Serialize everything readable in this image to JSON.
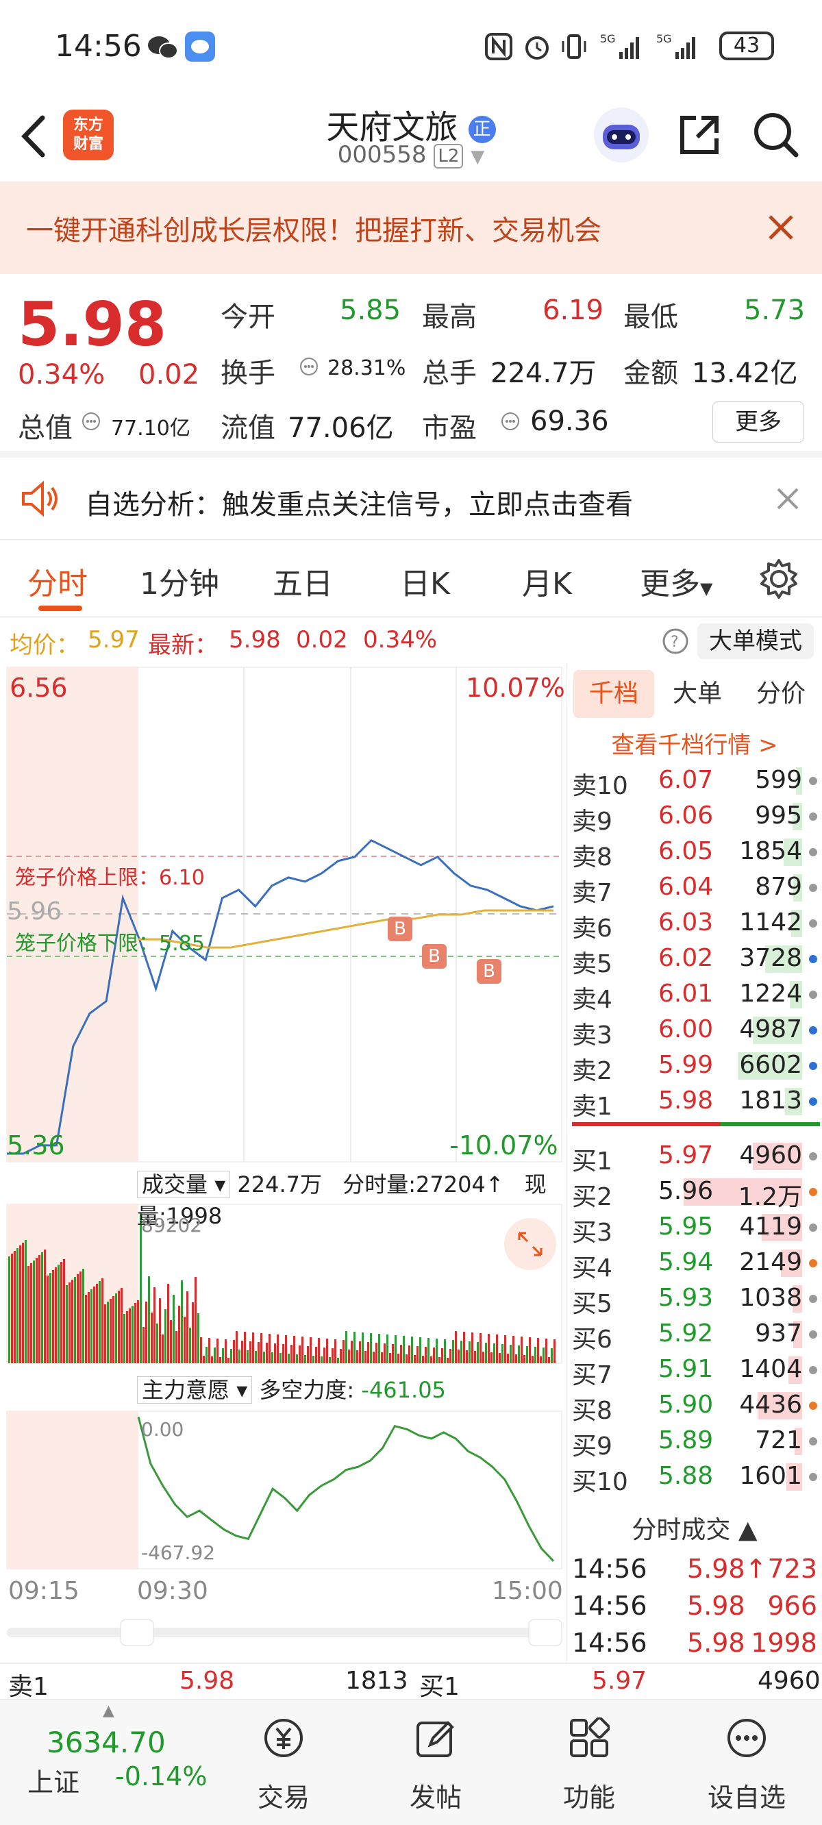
{
  "status_bar": {
    "time": "14:56",
    "battery": "43"
  },
  "header": {
    "logo_line1": "东方",
    "logo_line2": "财富",
    "stock_name": "天府文旅",
    "stock_code": "000558",
    "level_badge": "L2"
  },
  "banner": {
    "text": "一键开通科创成长层权限！把握打新、交易机会"
  },
  "quote": {
    "price": "5.98",
    "change_pct": "0.34%",
    "change": "0.02",
    "open_label": "今开",
    "open": "5.85",
    "high_label": "最高",
    "high": "6.19",
    "low_label": "最低",
    "low": "5.73",
    "turnover_label": "换手",
    "turnover": "28.31%",
    "volume_label": "总手",
    "volume": "224.7万",
    "amount_label": "金额",
    "amount": "13.42亿",
    "mktcap_label": "总值",
    "mktcap": "77.10亿",
    "float_label": "流值",
    "float": "77.06亿",
    "pe_label": "市盈",
    "pe": "69.36",
    "more_label": "更多"
  },
  "notice": {
    "text": "自选分析：触发重点关注信号，立即点击查看"
  },
  "tabs": [
    "分时",
    "1分钟",
    "五日",
    "日K",
    "月K",
    "更多"
  ],
  "avg_row": {
    "avg_label": "均价：",
    "avg": "5.97",
    "latest_label": "最新：",
    "latest": "5.98",
    "change": "0.02",
    "change_pct": "0.34%",
    "big_mode": "大单模式"
  },
  "chart_data": [
    {
      "type": "line",
      "title": "",
      "y_top_label": "6.56",
      "y_bottom_label": "5.36",
      "y_mid_label": "5.96",
      "pct_top": "10.07%",
      "pct_bottom": "-10.07%",
      "cage_upper_label": "笼子价格上限：6.10",
      "cage_lower_label": "笼子价格下限：5.85",
      "ylim": [
        5.36,
        6.56
      ],
      "time_labels": [
        "09:15",
        "09:30",
        "15:00"
      ],
      "markers": [
        "B",
        "B",
        "B"
      ],
      "series": [
        {
          "values": [
            5.38,
            5.38,
            5.4,
            5.4,
            5.64,
            5.72,
            5.75,
            6.0,
            5.9,
            5.78,
            5.92,
            5.88,
            5.85,
            6.0,
            6.02,
            5.98,
            6.03,
            6.05,
            6.04,
            6.06,
            6.09,
            6.1,
            6.14,
            6.12,
            6.1,
            6.08,
            6.1,
            6.06,
            6.03,
            6.02,
            6.0,
            5.98,
            5.97,
            5.98
          ]
        },
        {
          "values": [
            5.9,
            5.9,
            5.89,
            5.88,
            5.88,
            5.89,
            5.9,
            5.91,
            5.92,
            5.93,
            5.94,
            5.95,
            5.95,
            5.96,
            5.96,
            5.97,
            5.97,
            5.97,
            5.97
          ]
        }
      ]
    },
    {
      "type": "bar",
      "title": "成交量",
      "total_label": "224.7万",
      "min_vol_label": "分时量:27204↑",
      "cur_vol_label": "现量:1998",
      "ymax_label": "89202"
    },
    {
      "type": "line",
      "title": "主力意愿",
      "force_label": "多空力度:",
      "force_value": "-461.05",
      "y_top_label": "0.00",
      "y_bottom_label": "-467.92",
      "ylim": [
        -467.92,
        0
      ],
      "series": [
        {
          "values": [
            0,
            -150,
            -220,
            -280,
            -320,
            -300,
            -330,
            -360,
            -380,
            -390,
            -310,
            -230,
            -260,
            -300,
            -250,
            -220,
            -200,
            -170,
            -160,
            -140,
            -100,
            -30,
            -40,
            -60,
            -70,
            -50,
            -70,
            -110,
            -130,
            -160,
            -200,
            -270,
            -350,
            -420,
            -461
          ]
        }
      ]
    }
  ],
  "orderbook": {
    "tabs": [
      "千档",
      "大单",
      "分价"
    ],
    "link": "查看千档行情 >",
    "sells": [
      {
        "label": "卖10",
        "price": "6.07",
        "vol": "599",
        "bar": 0.05,
        "dot": "#999"
      },
      {
        "label": "卖9",
        "price": "6.06",
        "vol": "995",
        "bar": 0.08,
        "dot": "#999"
      },
      {
        "label": "卖8",
        "price": "6.05",
        "vol": "1854",
        "bar": 0.15,
        "dot": "#999"
      },
      {
        "label": "卖7",
        "price": "6.04",
        "vol": "879",
        "bar": 0.07,
        "dot": "#999"
      },
      {
        "label": "卖6",
        "price": "6.03",
        "vol": "1142",
        "bar": 0.09,
        "dot": "#999"
      },
      {
        "label": "卖5",
        "price": "6.02",
        "vol": "3728",
        "bar": 0.3,
        "dot": "#2e6fd6"
      },
      {
        "label": "卖4",
        "price": "6.01",
        "vol": "1224",
        "bar": 0.1,
        "dot": "#999"
      },
      {
        "label": "卖3",
        "price": "6.00",
        "vol": "4987",
        "bar": 0.4,
        "dot": "#2e6fd6"
      },
      {
        "label": "卖2",
        "price": "5.99",
        "vol": "6602",
        "bar": 0.52,
        "dot": "#2e6fd6"
      },
      {
        "label": "卖1",
        "price": "5.98",
        "vol": "1813",
        "bar": 0.14,
        "dot": "#2e6fd6"
      }
    ],
    "buys": [
      {
        "label": "买1",
        "price": "5.97",
        "vol": "4960",
        "bar": 0.4,
        "dot": "#999"
      },
      {
        "label": "买2",
        "price": "5.96",
        "vol": "1.2万",
        "bar": 0.96,
        "dot": "#e87b2a"
      },
      {
        "label": "买3",
        "price": "5.95",
        "vol": "4119",
        "bar": 0.33,
        "dot": "#999"
      },
      {
        "label": "买4",
        "price": "5.94",
        "vol": "2149",
        "bar": 0.17,
        "dot": "#e87b2a"
      },
      {
        "label": "买5",
        "price": "5.93",
        "vol": "1038",
        "bar": 0.08,
        "dot": "#999"
      },
      {
        "label": "买6",
        "price": "5.92",
        "vol": "937",
        "bar": 0.07,
        "dot": "#999"
      },
      {
        "label": "买7",
        "price": "5.91",
        "vol": "1404",
        "bar": 0.11,
        "dot": "#999"
      },
      {
        "label": "买8",
        "price": "5.90",
        "vol": "4436",
        "bar": 0.36,
        "dot": "#e87b2a"
      },
      {
        "label": "买9",
        "price": "5.89",
        "vol": "721",
        "bar": 0.06,
        "dot": "#999"
      },
      {
        "label": "买10",
        "price": "5.88",
        "vol": "1601",
        "bar": 0.13,
        "dot": "#999"
      }
    ],
    "trade_title": "分时成交",
    "trades": [
      {
        "time": "14:56",
        "price": "5.98↑",
        "vol": "723"
      },
      {
        "time": "14:56",
        "price": "5.98",
        "vol": "966"
      },
      {
        "time": "14:56",
        "price": "5.98",
        "vol": "1998"
      }
    ]
  },
  "bidask": {
    "sell1_label": "卖1",
    "sell1_price": "5.98",
    "sell1_vol": "1813",
    "buy1_label": "买1",
    "buy1_price": "5.97",
    "buy1_vol": "4960"
  },
  "bottom_nav": {
    "index_value": "3634.70",
    "index_name": "上证",
    "index_change": "-0.14%",
    "items": [
      "交易",
      "发帖",
      "功能",
      "设自选"
    ]
  }
}
